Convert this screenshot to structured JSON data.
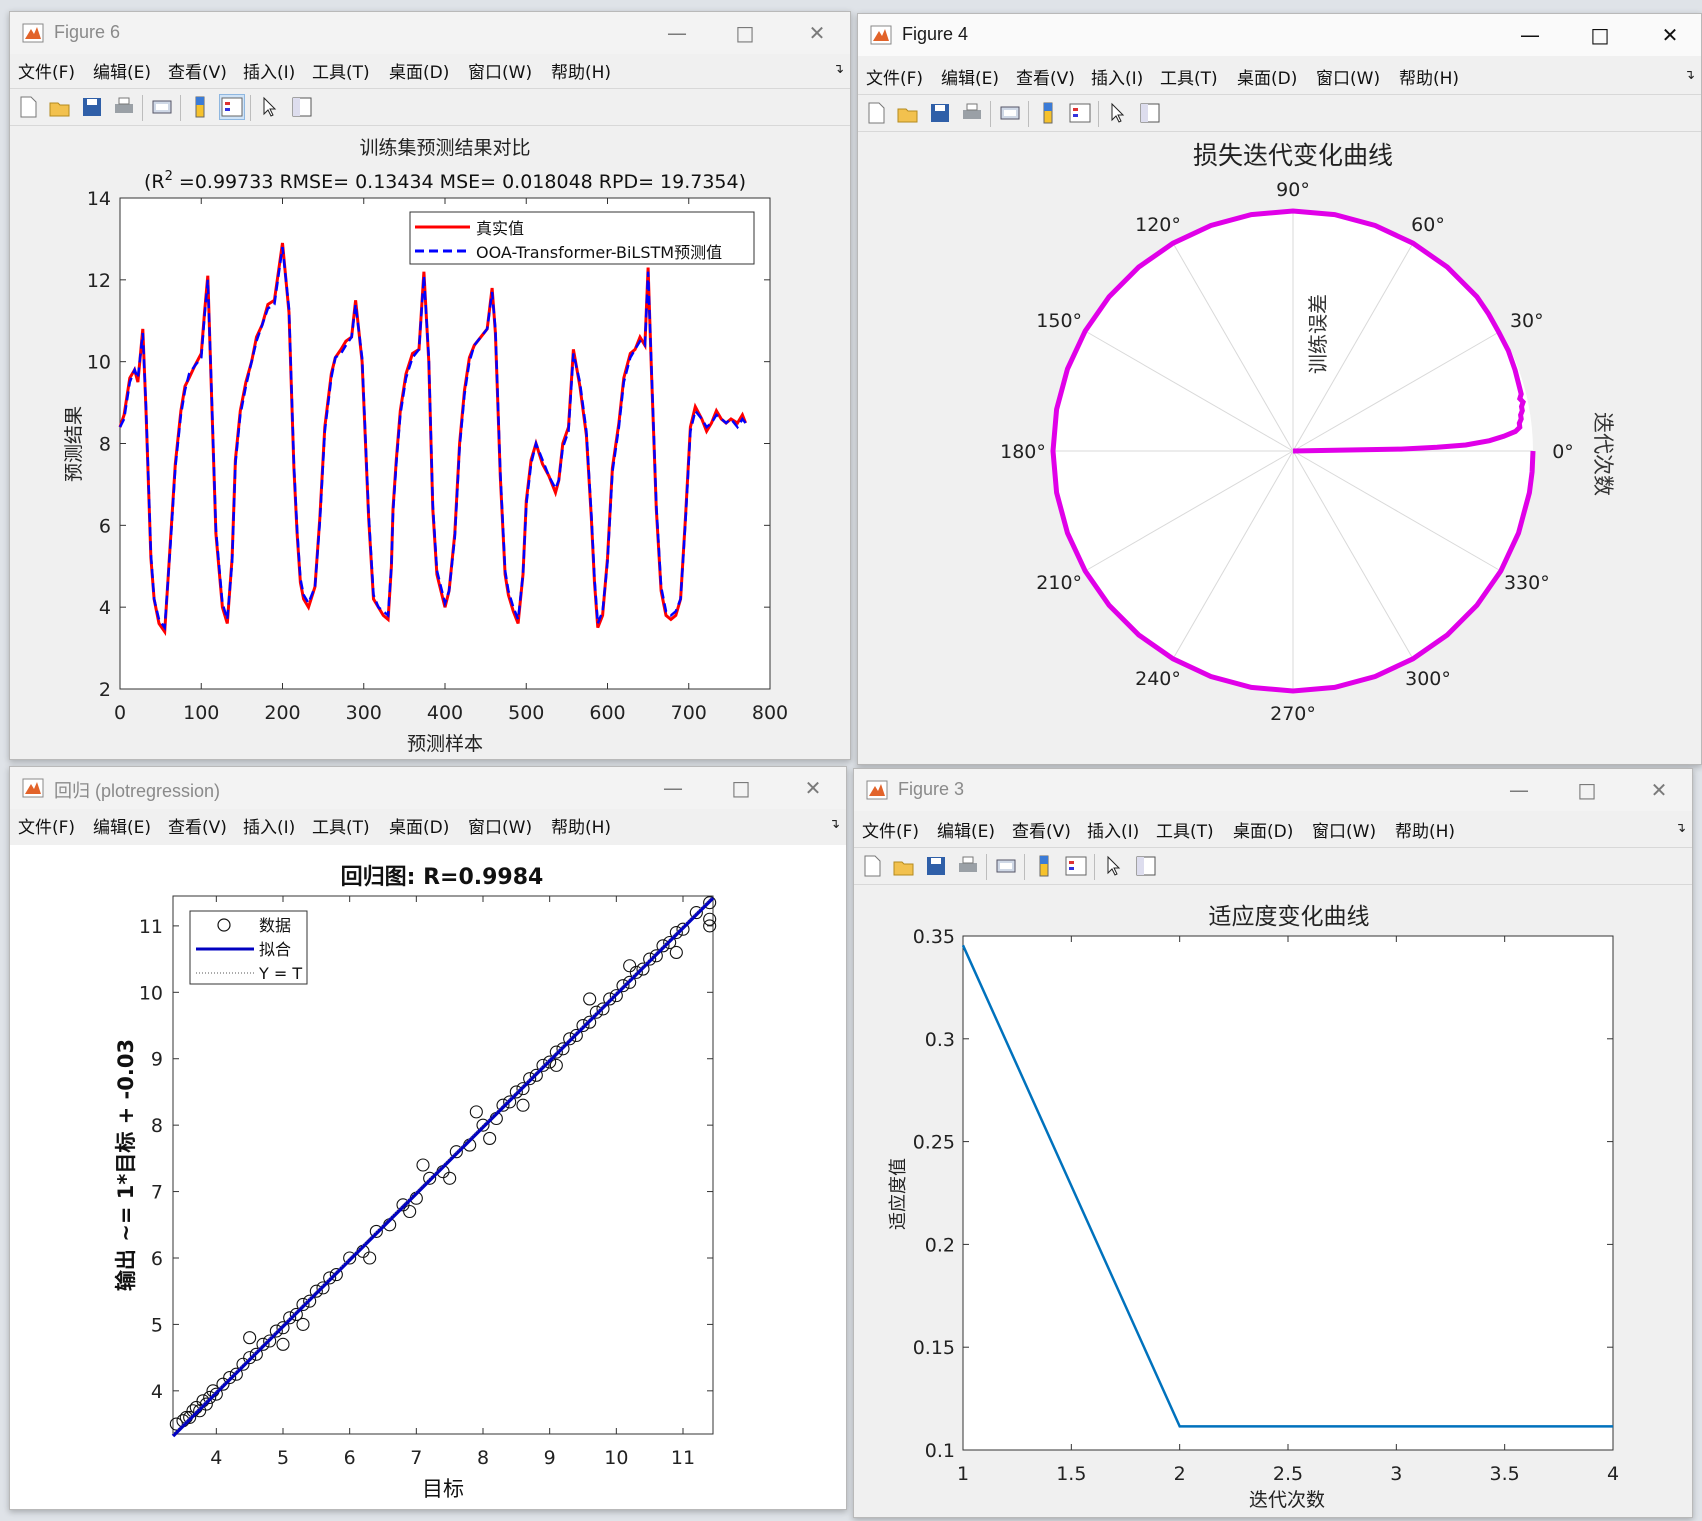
{
  "menu": [
    "文件(F)",
    "编辑(E)",
    "查看(V)",
    "插入(I)",
    "工具(T)",
    "桌面(D)",
    "窗口(W)",
    "帮助(H)"
  ],
  "figure6": {
    "title": "Figure 6",
    "plot_title": "训练集预测结果对比",
    "metrics_prefix": "(R",
    "metrics_sup": "2",
    "metrics_rest": " =0.99733 RMSE= 0.13434 MSE= 0.018048 RPD= 19.7354)",
    "xlabel": "预测样本",
    "ylabel": "预测结果",
    "legend": [
      "真实值",
      "OOA-Transformer-BiLSTM预测值"
    ]
  },
  "figure4": {
    "title": "Figure 4",
    "plot_title": "损失迭代变化曲线",
    "r_label": "训练误差",
    "theta_label": "迭代次数"
  },
  "regression": {
    "title": "回归 (plotregression)",
    "plot_title": "回归图: R=0.9984",
    "xlabel": "目标",
    "ylabel": "输出 ~= 1*目标 + -0.03",
    "legend": [
      "数据",
      "拟合",
      "Y = T"
    ]
  },
  "figure3": {
    "title": "Figure 3",
    "plot_title": "适应度变化曲线",
    "xlabel": "迭代次数",
    "ylabel": "适应度值"
  },
  "colors": {
    "true": "#ff0000",
    "pred": "#0000ff",
    "polar": "#e000e8",
    "fitness": "#0072bd",
    "fit_line": "#0000c0"
  },
  "chart_data": [
    {
      "type": "line",
      "title": "训练集预测结果对比",
      "xlabel": "预测样本",
      "ylabel": "预测结果",
      "xlim": [
        0,
        800
      ],
      "ylim": [
        2,
        14
      ],
      "xticks": [
        0,
        100,
        200,
        300,
        400,
        500,
        600,
        700,
        800
      ],
      "yticks": [
        2,
        4,
        6,
        8,
        10,
        12,
        14
      ],
      "series": [
        {
          "name": "真实值",
          "x": [
            0,
            5,
            12,
            18,
            22,
            28,
            32,
            38,
            42,
            48,
            55,
            62,
            68,
            75,
            80,
            85,
            92,
            100,
            104,
            108,
            112,
            118,
            126,
            132,
            138,
            142,
            148,
            155,
            162,
            168,
            175,
            182,
            190,
            200,
            208,
            214,
            218,
            222,
            226,
            232,
            240,
            246,
            252,
            260,
            265,
            272,
            278,
            285,
            290,
            298,
            306,
            312,
            318,
            324,
            330,
            334,
            336,
            340,
            345,
            352,
            360,
            368,
            374,
            380,
            385,
            390,
            395,
            400,
            405,
            412,
            418,
            424,
            430,
            436,
            444,
            452,
            458,
            462,
            468,
            474,
            478,
            484,
            490,
            496,
            500,
            506,
            512,
            520,
            528,
            536,
            540,
            545,
            552,
            558,
            566,
            574,
            580,
            584,
            588,
            594,
            600,
            606,
            614,
            620,
            628,
            634,
            640,
            646,
            650,
            654,
            660,
            666,
            672,
            678,
            684,
            690,
            696,
            702,
            708,
            716,
            722,
            728,
            734,
            740,
            746,
            752,
            760,
            766,
            770
          ],
          "y": [
            8.4,
            8.7,
            9.6,
            9.8,
            9.5,
            10.8,
            8.8,
            5.2,
            4.2,
            3.6,
            3.4,
            5.6,
            7.5,
            8.8,
            9.4,
            9.6,
            9.9,
            10.2,
            11.2,
            12.1,
            9.6,
            5.8,
            4.0,
            3.6,
            5.2,
            7.6,
            8.8,
            9.5,
            10.0,
            10.6,
            10.9,
            11.4,
            11.5,
            12.9,
            11.2,
            7.4,
            5.8,
            4.6,
            4.2,
            4.0,
            4.5,
            6.2,
            8.4,
            9.7,
            10.1,
            10.3,
            10.5,
            10.6,
            11.5,
            10.0,
            6.2,
            4.2,
            4.0,
            3.8,
            3.7,
            5.0,
            6.4,
            7.6,
            8.8,
            9.7,
            10.2,
            10.3,
            12.2,
            10.0,
            6.4,
            4.8,
            4.4,
            4.0,
            4.4,
            5.8,
            8.0,
            9.3,
            10.1,
            10.4,
            10.6,
            10.8,
            11.8,
            10.7,
            7.2,
            4.8,
            4.3,
            3.9,
            3.6,
            4.8,
            6.6,
            7.6,
            8.0,
            7.5,
            7.2,
            6.8,
            7.1,
            8.0,
            8.4,
            10.3,
            9.4,
            8.2,
            6.2,
            4.6,
            3.5,
            3.8,
            5.2,
            7.4,
            8.5,
            9.6,
            10.2,
            10.3,
            10.6,
            10.4,
            12.3,
            9.8,
            6.4,
            4.4,
            3.8,
            3.7,
            3.8,
            4.2,
            6.2,
            8.4,
            8.9,
            8.6,
            8.3,
            8.5,
            8.8,
            8.6,
            8.5,
            8.6,
            8.5,
            8.7,
            8.5
          ]
        },
        {
          "name": "OOA-Transformer-BiLSTM预测值",
          "x": [
            0,
            5,
            12,
            18,
            22,
            28,
            32,
            38,
            42,
            48,
            55,
            62,
            68,
            75,
            80,
            85,
            92,
            100,
            104,
            108,
            112,
            118,
            126,
            132,
            138,
            142,
            148,
            155,
            162,
            168,
            175,
            182,
            190,
            200,
            208,
            214,
            218,
            222,
            226,
            232,
            240,
            246,
            252,
            260,
            265,
            272,
            278,
            285,
            290,
            298,
            306,
            312,
            318,
            324,
            330,
            334,
            336,
            340,
            345,
            352,
            360,
            368,
            374,
            380,
            385,
            390,
            395,
            400,
            405,
            412,
            418,
            424,
            430,
            436,
            444,
            452,
            458,
            462,
            468,
            474,
            478,
            484,
            490,
            496,
            500,
            506,
            512,
            520,
            528,
            536,
            540,
            545,
            552,
            558,
            566,
            574,
            580,
            584,
            588,
            594,
            600,
            606,
            614,
            620,
            628,
            634,
            640,
            646,
            650,
            654,
            660,
            666,
            672,
            678,
            684,
            690,
            696,
            702,
            708,
            716,
            722,
            728,
            734,
            740,
            746,
            752,
            760,
            766,
            770
          ],
          "y": [
            8.4,
            8.6,
            9.5,
            9.8,
            9.6,
            10.7,
            8.9,
            5.3,
            4.2,
            3.7,
            3.5,
            5.5,
            7.4,
            8.7,
            9.3,
            9.7,
            9.9,
            10.1,
            11.1,
            12.0,
            9.7,
            5.9,
            4.1,
            3.7,
            5.1,
            7.5,
            8.7,
            9.4,
            10.0,
            10.5,
            10.9,
            11.3,
            11.4,
            12.8,
            11.3,
            7.5,
            5.9,
            4.7,
            4.3,
            4.1,
            4.5,
            6.1,
            8.3,
            9.6,
            10.1,
            10.2,
            10.4,
            10.6,
            11.4,
            10.1,
            6.3,
            4.3,
            4.0,
            3.9,
            3.8,
            5.0,
            6.3,
            7.5,
            8.7,
            9.6,
            10.1,
            10.3,
            12.1,
            10.1,
            6.5,
            4.9,
            4.5,
            4.1,
            4.4,
            5.7,
            7.9,
            9.2,
            10.0,
            10.4,
            10.6,
            10.8,
            11.7,
            10.8,
            7.3,
            4.9,
            4.4,
            4.0,
            3.7,
            4.8,
            6.5,
            7.5,
            8.0,
            7.6,
            7.2,
            6.9,
            7.1,
            7.9,
            8.3,
            10.2,
            9.5,
            8.3,
            6.3,
            4.7,
            3.6,
            3.9,
            5.1,
            7.3,
            8.4,
            9.5,
            10.1,
            10.3,
            10.5,
            10.4,
            12.2,
            9.9,
            6.5,
            4.5,
            3.9,
            3.8,
            3.9,
            4.2,
            6.1,
            8.3,
            8.8,
            8.6,
            8.4,
            8.5,
            8.7,
            8.6,
            8.5,
            8.6,
            8.4,
            8.6,
            8.5
          ]
        }
      ]
    },
    {
      "type": "line",
      "title": "损失迭代变化曲线",
      "projection": "polar",
      "theta_ticks_deg": [
        0,
        30,
        60,
        90,
        120,
        150,
        180,
        210,
        240,
        270,
        300,
        330
      ],
      "series": [
        {
          "name": "",
          "theta_deg": [
            0,
            1,
            1.5,
            2,
            3,
            4,
            5,
            6,
            7,
            8,
            9,
            10,
            11,
            12,
            13,
            14,
            15,
            20,
            25,
            30,
            35,
            40,
            50,
            60,
            70,
            80,
            90,
            100,
            110,
            120,
            130,
            140,
            150,
            160,
            170,
            180,
            190,
            200,
            210,
            220,
            230,
            240,
            250,
            260,
            270,
            280,
            290,
            300,
            310,
            320,
            330,
            340,
            350,
            355,
            360
          ],
          "r": [
            0.0,
            0.45,
            0.6,
            0.72,
            0.82,
            0.88,
            0.93,
            0.95,
            0.95,
            0.96,
            0.96,
            0.97,
            0.97,
            0.98,
            0.97,
            0.98,
            0.98,
            0.985,
            0.99,
            0.99,
            0.995,
            1.0,
            1.0,
            1.0,
            1.0,
            1.0,
            1.0,
            1.0,
            1.0,
            1.0,
            1.0,
            1.0,
            1.0,
            1.0,
            1.0,
            1.0,
            1.0,
            1.0,
            1.0,
            1.0,
            1.0,
            1.0,
            1.0,
            1.0,
            1.0,
            1.0,
            1.0,
            1.0,
            1.0,
            1.0,
            1.0,
            1.0,
            1.0,
            1.0,
            1.0
          ]
        }
      ]
    },
    {
      "type": "scatter",
      "title": "回归图: R=0.9984",
      "xlabel": "目标",
      "ylabel": "输出 ~= 1*目标 + -0.03",
      "xlim": [
        3.35,
        11.45
      ],
      "ylim": [
        3.35,
        11.45
      ],
      "xticks": [
        4,
        5,
        6,
        7,
        8,
        9,
        10,
        11
      ],
      "yticks": [
        4,
        5,
        6,
        7,
        8,
        9,
        10,
        11
      ],
      "fit": {
        "slope": 1,
        "intercept": -0.03
      },
      "series": [
        {
          "name": "数据",
          "x": [
            3.4,
            3.5,
            3.55,
            3.6,
            3.65,
            3.7,
            3.75,
            3.8,
            3.85,
            3.9,
            3.95,
            4.0,
            4.1,
            4.2,
            4.3,
            4.4,
            4.5,
            4.6,
            4.7,
            4.8,
            4.9,
            5.0,
            5.1,
            5.2,
            5.3,
            5.4,
            5.5,
            5.6,
            5.7,
            5.8,
            6.0,
            6.2,
            6.4,
            6.6,
            6.8,
            7.0,
            7.2,
            7.4,
            7.6,
            7.8,
            8.0,
            8.2,
            8.3,
            8.4,
            8.5,
            8.6,
            8.7,
            8.8,
            8.9,
            9.0,
            9.1,
            9.2,
            9.3,
            9.4,
            9.5,
            9.6,
            9.7,
            9.8,
            9.9,
            10.0,
            10.1,
            10.2,
            10.3,
            10.4,
            10.5,
            10.6,
            10.7,
            10.8,
            10.9,
            11.0,
            11.2,
            11.4,
            4.5,
            5.0,
            5.3,
            6.3,
            6.9,
            7.1,
            7.5,
            7.9,
            8.1,
            8.6,
            9.1,
            9.6,
            10.2,
            10.9,
            11.4,
            11.4
          ],
          "y": [
            3.5,
            3.55,
            3.6,
            3.6,
            3.7,
            3.75,
            3.7,
            3.85,
            3.8,
            3.9,
            4.0,
            3.95,
            4.1,
            4.2,
            4.25,
            4.4,
            4.5,
            4.55,
            4.7,
            4.75,
            4.9,
            4.95,
            5.1,
            5.15,
            5.3,
            5.35,
            5.5,
            5.55,
            5.7,
            5.75,
            6.0,
            6.1,
            6.4,
            6.5,
            6.8,
            6.9,
            7.2,
            7.3,
            7.6,
            7.7,
            8.0,
            8.1,
            8.3,
            8.35,
            8.5,
            8.55,
            8.7,
            8.75,
            8.9,
            8.95,
            9.1,
            9.15,
            9.3,
            9.35,
            9.5,
            9.55,
            9.7,
            9.75,
            9.9,
            9.95,
            10.1,
            10.15,
            10.3,
            10.35,
            10.5,
            10.55,
            10.7,
            10.75,
            10.9,
            10.95,
            11.2,
            11.35,
            4.8,
            4.7,
            5.0,
            6.0,
            6.7,
            7.4,
            7.2,
            8.2,
            7.8,
            8.3,
            8.9,
            9.9,
            10.4,
            10.6,
            11.1,
            11.0
          ]
        },
        {
          "name": "拟合",
          "x": [
            3.35,
            11.45
          ],
          "y": [
            3.32,
            11.42
          ]
        },
        {
          "name": "Y = T",
          "x": [
            3.35,
            11.45
          ],
          "y": [
            3.35,
            11.45
          ]
        }
      ]
    },
    {
      "type": "line",
      "title": "适应度变化曲线",
      "xlabel": "迭代次数",
      "ylabel": "适应度值",
      "xlim": [
        1,
        4
      ],
      "ylim": [
        0.1,
        0.35
      ],
      "xticks": [
        1,
        1.5,
        2,
        2.5,
        3,
        3.5,
        4
      ],
      "yticks": [
        0.1,
        0.15,
        0.2,
        0.25,
        0.3,
        0.35
      ],
      "series": [
        {
          "name": "",
          "x": [
            1,
            2,
            3,
            4
          ],
          "y": [
            0.3455,
            0.1115,
            0.1115,
            0.1115
          ]
        }
      ]
    }
  ]
}
